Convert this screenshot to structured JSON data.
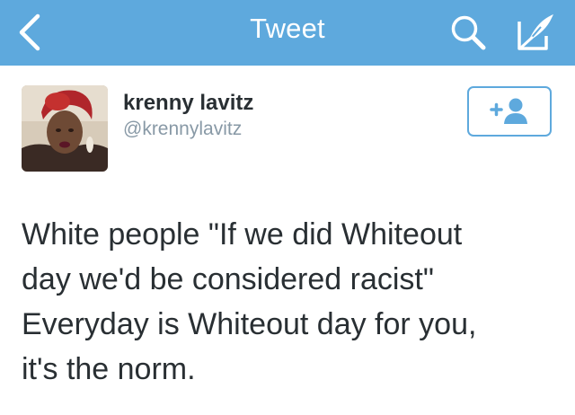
{
  "navbar": {
    "title": "Tweet",
    "background_color": "#5ea9dd",
    "icons": [
      "chevron-left-icon",
      "search-icon",
      "compose-icon"
    ]
  },
  "tweet": {
    "author": {
      "display_name": "krenny lavitz",
      "handle": "@krennylavitz",
      "avatar": "profile-photo"
    },
    "follow_button_icon": "add-user-icon",
    "text_lines": [
      "White people \"If we did Whiteout",
      "day we'd be considered racist\"",
      "Everyday is Whiteout day for you,",
      "it's the norm."
    ]
  },
  "colors": {
    "accent": "#5ea9dd",
    "text": "#292f33",
    "secondary_text": "#8899a6"
  }
}
